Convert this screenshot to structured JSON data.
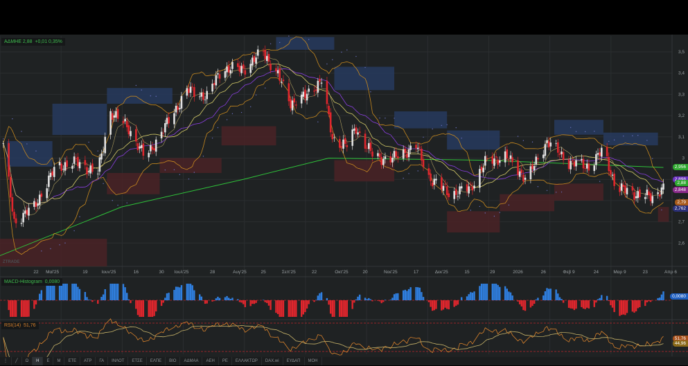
{
  "header": {
    "symbol": "ΑΔΜΗΕ",
    "price": "2,88",
    "change": "+0,01",
    "change_pct": "0,35%"
  },
  "watermark": "ZTRADE",
  "macd": {
    "label": "MACD-Histogram",
    "value": "0,0080",
    "tag": "0,0080"
  },
  "rsi": {
    "label": "RSI(14)",
    "value": "51,76",
    "tags": [
      "51,76",
      "44,96"
    ]
  },
  "toolbar": {
    "items": [
      "⋮",
      "╱",
      "Ω",
      "Η",
      "Ε",
      "Μ",
      "ΕΤΕ",
      "ΑΤΡ",
      "ΓΑ",
      "ΙΝΛΟΤ",
      "ΕΤΣΕ",
      "ΕΛΠΕ",
      "ΒΙΟ",
      "ΑΔΜΑΑ",
      "ΑΕΗ",
      "ΡΕ",
      "ΕΛΛΑΚΤΩΡ",
      "DAX.wi",
      "ΕΥΔΑΠ",
      "ΜΟΗ"
    ],
    "active": "Η"
  },
  "colors": {
    "up": "#e2e2e2",
    "down": "#e0262d",
    "ma_long": "#2fc43a",
    "band": "#c98a1f",
    "mid": "#d9cf6a",
    "ma_mid": "#8a3fe0",
    "supply_zone": "#27395e",
    "demand_zone": "#4a2226",
    "macd_pos": "#2f7fe0",
    "macd_neg": "#e0262d",
    "rsi": "#d9822b",
    "rsi_signal": "#c9b56a"
  },
  "chart_data": {
    "type": "candlestick",
    "title": "",
    "y_ticks": [
      "3,5",
      "3,4",
      "3,3",
      "3,2",
      "3,1",
      "3",
      "2,9",
      "2,8",
      "2,7",
      "2,6"
    ],
    "y_tick_values": [
      3.5,
      3.4,
      3.3,
      3.2,
      3.1,
      3.0,
      2.9,
      2.8,
      2.7,
      2.6
    ],
    "ylim": [
      2.49,
      3.57
    ],
    "x_ticks": [
      {
        "label": "22",
        "date": "2025-04-22"
      },
      {
        "label": "Μαϊ'25",
        "date": "2025-05-01"
      },
      {
        "label": "19",
        "date": "2025-05-19"
      },
      {
        "label": "Ιουν'25",
        "date": "2025-06-01"
      },
      {
        "label": "16",
        "date": "2025-06-16"
      },
      {
        "label": "30",
        "date": "2025-06-30"
      },
      {
        "label": "Ιουλ'25",
        "date": "2025-07-11"
      },
      {
        "label": "28",
        "date": "2025-07-28"
      },
      {
        "label": "Αυγ'25",
        "date": "2025-08-12"
      },
      {
        "label": "25",
        "date": "2025-08-25"
      },
      {
        "label": "Σεπ'25",
        "date": "2025-09-08"
      },
      {
        "label": "22",
        "date": "2025-09-22"
      },
      {
        "label": "Οκτ'25",
        "date": "2025-10-07"
      },
      {
        "label": "20",
        "date": "2025-10-20"
      },
      {
        "label": "Νοε'25",
        "date": "2025-11-03"
      },
      {
        "label": "17",
        "date": "2025-11-17"
      },
      {
        "label": "Δεκ'25",
        "date": "2025-12-01"
      },
      {
        "label": "15",
        "date": "2025-12-15"
      },
      {
        "label": "29",
        "date": "2025-12-29"
      },
      {
        "label": "2026",
        "date": "2026-01-12"
      },
      {
        "label": "26",
        "date": "2026-01-26"
      },
      {
        "label": "Φεβ 9",
        "date": "2026-02-09"
      },
      {
        "label": "24",
        "date": "2026-02-24"
      },
      {
        "label": "Μαρ 9",
        "date": "2026-03-09"
      },
      {
        "label": "23",
        "date": "2026-03-23"
      },
      {
        "label": "Απρ 6",
        "date": "2026-04-06"
      }
    ],
    "close_path": [
      [
        "2025-04-04",
        3.06
      ],
      [
        "2025-04-10",
        2.7
      ],
      [
        "2025-04-21",
        2.77
      ],
      [
        "2025-05-03",
        2.96
      ],
      [
        "2025-05-14",
        2.98
      ],
      [
        "2025-05-26",
        2.93
      ],
      [
        "2025-06-02",
        3.22
      ],
      [
        "2025-06-12",
        3.14
      ],
      [
        "2025-06-21",
        3.0
      ],
      [
        "2025-07-03",
        3.16
      ],
      [
        "2025-07-14",
        3.32
      ],
      [
        "2025-07-25",
        3.29
      ],
      [
        "2025-08-02",
        3.42
      ],
      [
        "2025-08-14",
        3.42
      ],
      [
        "2025-08-25",
        3.5
      ],
      [
        "2025-09-02",
        3.39
      ],
      [
        "2025-09-09",
        3.26
      ],
      [
        "2025-09-17",
        3.29
      ],
      [
        "2025-09-26",
        3.37
      ],
      [
        "2025-10-02",
        3.09
      ],
      [
        "2025-10-10",
        3.06
      ],
      [
        "2025-10-15",
        3.14
      ],
      [
        "2025-10-25",
        3.0
      ],
      [
        "2025-11-05",
        3.0
      ],
      [
        "2025-11-17",
        3.06
      ],
      [
        "2025-11-24",
        2.91
      ],
      [
        "2025-12-06",
        2.83
      ],
      [
        "2025-12-17",
        2.86
      ],
      [
        "2025-12-25",
        2.98
      ],
      [
        "2026-01-05",
        3.01
      ],
      [
        "2026-01-17",
        2.9
      ],
      [
        "2026-01-28",
        3.08
      ],
      [
        "2026-02-09",
        2.98
      ],
      [
        "2026-02-20",
        2.96
      ],
      [
        "2026-02-28",
        3.04
      ],
      [
        "2026-03-07",
        2.86
      ],
      [
        "2026-03-19",
        2.83
      ],
      [
        "2026-03-28",
        2.81
      ],
      [
        "2026-04-02",
        2.88
      ]
    ],
    "ma_long_path": [
      [
        "2025-04-02",
        2.54
      ],
      [
        "2025-06-08",
        2.77
      ],
      [
        "2025-08-14",
        2.9
      ],
      [
        "2025-09-30",
        3.0
      ],
      [
        "2025-12-25",
        2.99
      ],
      [
        "2026-04-02",
        2.956
      ]
    ],
    "zones": [
      {
        "kind": "supply",
        "from": "2025-04-06",
        "to": "2025-05-01",
        "high": 3.08,
        "low": 2.96
      },
      {
        "kind": "supply",
        "from": "2025-05-01",
        "to": "2025-05-31",
        "high": 3.256,
        "low": 3.109
      },
      {
        "kind": "supply",
        "from": "2025-05-31",
        "to": "2025-07-06",
        "high": 3.33,
        "low": 3.256
      },
      {
        "kind": "supply",
        "from": "2025-09-01",
        "to": "2025-10-03",
        "high": 3.57,
        "low": 3.51
      },
      {
        "kind": "supply",
        "from": "2025-10-03",
        "to": "2025-11-05",
        "high": 3.43,
        "low": 3.32
      },
      {
        "kind": "supply",
        "from": "2025-11-05",
        "to": "2025-12-04",
        "high": 3.22,
        "low": 3.14
      },
      {
        "kind": "supply",
        "from": "2025-12-04",
        "to": "2026-01-02",
        "high": 3.13,
        "low": 3.04
      },
      {
        "kind": "supply",
        "from": "2026-02-01",
        "to": "2026-02-28",
        "high": 3.18,
        "low": 3.11
      },
      {
        "kind": "supply",
        "from": "2026-02-28",
        "to": "2026-03-30",
        "high": 3.12,
        "low": 3.06
      },
      {
        "kind": "demand",
        "from": "2025-04-02",
        "to": "2025-05-31",
        "high": 2.62,
        "low": 2.49
      },
      {
        "kind": "demand",
        "from": "2025-05-31",
        "to": "2025-06-29",
        "high": 2.93,
        "low": 2.83
      },
      {
        "kind": "demand",
        "from": "2025-06-29",
        "to": "2025-08-02",
        "high": 3.0,
        "low": 2.93
      },
      {
        "kind": "demand",
        "from": "2025-08-02",
        "to": "2025-09-01",
        "high": 3.15,
        "low": 3.06
      },
      {
        "kind": "demand",
        "from": "2025-10-03",
        "to": "2025-11-05",
        "high": 2.99,
        "low": 2.89
      },
      {
        "kind": "demand",
        "from": "2025-12-04",
        "to": "2026-01-02",
        "high": 2.75,
        "low": 2.65
      },
      {
        "kind": "demand",
        "from": "2026-01-02",
        "to": "2026-02-01",
        "high": 2.83,
        "low": 2.75
      },
      {
        "kind": "demand",
        "from": "2026-02-01",
        "to": "2026-02-28",
        "high": 2.88,
        "low": 2.8
      },
      {
        "kind": "demand",
        "from": "2026-03-30",
        "to": "2026-04-05",
        "high": 2.77,
        "low": 2.7
      }
    ],
    "price_tags": [
      {
        "text": "2,956",
        "price": 2.956,
        "color": "#2fa82f"
      },
      {
        "text": "2,898",
        "price": 2.898,
        "color": "#6a2fc0"
      },
      {
        "text": "2,88",
        "price": 2.88,
        "color": "#2fa82f"
      },
      {
        "text": "2,848",
        "price": 2.848,
        "color": "#8a2a8a"
      },
      {
        "text": "2,79",
        "price": 2.79,
        "color": "#a85a1a"
      },
      {
        "text": "2,762",
        "price": 2.762,
        "color": "#2a2f78"
      }
    ]
  }
}
